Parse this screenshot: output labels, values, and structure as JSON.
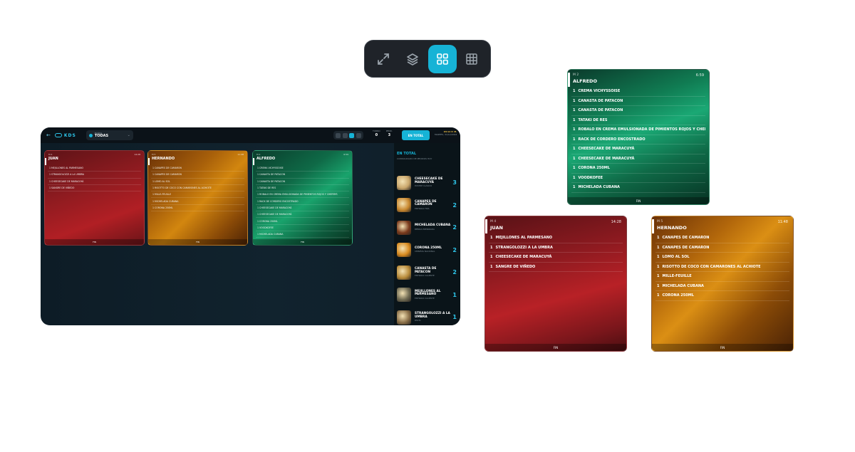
{
  "colors": {
    "accent": "#16b3d6",
    "red": "#b11f24",
    "orange": "#d2860f",
    "green": "#19a36c",
    "dark": "#0d1c26"
  },
  "switcher": {
    "buttons": [
      {
        "icon": "expand-icon",
        "active": false
      },
      {
        "icon": "layers-icon",
        "active": false
      },
      {
        "icon": "grid-2x2-icon",
        "active": true
      },
      {
        "icon": "grid-3x3-icon",
        "active": false
      }
    ]
  },
  "kds": {
    "brand": "KDS",
    "filter": {
      "label": "FILTRO",
      "value": "TODAS"
    },
    "stats": [
      {
        "label": "TURNO",
        "value": "0"
      },
      {
        "label": "PEND.",
        "value": "3"
      }
    ],
    "total_button": "EN TOTAL",
    "date_line1": "03:12 P. M.",
    "date_line2": "MARTES, 31/12/2024",
    "tickets": [
      {
        "key": "M 4",
        "time": "14:28",
        "name": "JUAN",
        "color": "red",
        "items": [
          "1 MEJILLONES AL PARMESANO",
          "1 STRANGOLOZZI A LA UMBRA",
          "1 CHEESECAKE DE MARACUYÁ",
          "1 SANGRE DE VIÑEDO"
        ],
        "footer": "FIN"
      },
      {
        "key": "M 5",
        "time": "11:48",
        "name": "HERNANDO",
        "color": "orange",
        "items": [
          "1 CANAPES DE CAMARON",
          "1 CANAPES DE CAMARON",
          "1 LOMO AL SOL",
          "1 RISOTTO DE COCO CON CAMARONES AL ACHIOTE",
          "1 MILLE-FEUILLE",
          "1 MICHELADA CUBANA",
          "1 CORONA 250ML"
        ],
        "footer": "FIN"
      },
      {
        "key": "M 2",
        "time": "6:59",
        "name": "ALFREDO",
        "color": "green",
        "items": [
          "1 CREMA VICHYSSOISE",
          "1 CANASTA DE PATACON",
          "1 CANASTA DE PATACON",
          "1 TATAKI DE RES",
          "1 ROBALO EN CREMA EMULSIONADA DE PIMIENTOS ROJOS Y CHERRYS",
          "1 RACK DE CORDERO ENCOSTRADO",
          "1 CHEESECAKE DE MARACUYÁ",
          "1 CHEESECAKE DE MARACUYÁ",
          "1 CORONA 250ML",
          "1 VOODKOFEE",
          "1 MICHELADA CUBANA"
        ],
        "footer": "FIN"
      }
    ],
    "panel": {
      "title": "EN TOTAL",
      "subtitle": "CONSOLIDADO DE PEDIDOS HOY",
      "items": [
        {
          "name": "CHEESECAKE DE MARACUYÁ",
          "sub": "POSTRE CLÁSICO",
          "qty": "3",
          "color": "#c9a66b"
        },
        {
          "name": "CANAPES DE CAMARON",
          "sub": "ENTRADA FRÍA",
          "qty": "2",
          "color": "#c8872e"
        },
        {
          "name": "MICHELADA CUBANA",
          "sub": "BEBIDA PREPARADA",
          "qty": "2",
          "color": "#7a3a1c"
        },
        {
          "name": "CORONA 250ML",
          "sub": "CERVEZA NACIONAL",
          "qty": "2",
          "color": "#d88a1f"
        },
        {
          "name": "CANASTA DE PATACON",
          "sub": "ENTRADA CALIENTE",
          "qty": "2",
          "color": "#b88b3a"
        },
        {
          "name": "MEJILLONES AL PARMESANO",
          "sub": "ENTRADA CALIENTE",
          "qty": "1",
          "color": "#6f6a52"
        },
        {
          "name": "STRANGOLOZZI A LA UMBRA",
          "sub": "PASTA",
          "qty": "1",
          "color": "#8a6f48"
        }
      ]
    }
  },
  "large_tickets": [
    {
      "key": "M 2",
      "time": "6:59",
      "name": "ALFREDO",
      "color": "green",
      "items": [
        {
          "q": "1",
          "name": "CREMA VICHYSSOISE"
        },
        {
          "q": "1",
          "name": "CANASTA DE PATACON"
        },
        {
          "q": "1",
          "name": "CANASTA DE PATACON"
        },
        {
          "q": "1",
          "name": "TATAKI DE RES"
        },
        {
          "q": "1",
          "name": "ROBALO EN CREMA EMULSIONADA DE PIMIENTOS ROJOS Y CHERRYS"
        },
        {
          "q": "1",
          "name": "RACK DE CORDERO ENCOSTRADO"
        },
        {
          "q": "1",
          "name": "CHEESECAKE DE MARACUYÁ"
        },
        {
          "q": "1",
          "name": "CHEESECAKE DE MARACUYÁ"
        },
        {
          "q": "1",
          "name": "CORONA 250ML"
        },
        {
          "q": "1",
          "name": "VOODKOFEE"
        },
        {
          "q": "1",
          "name": "MICHELADA CUBANA"
        }
      ],
      "footer": "FIN"
    },
    {
      "key": "M 4",
      "time": "14:28",
      "name": "JUAN",
      "color": "red",
      "items": [
        {
          "q": "1",
          "name": "MEJILLONES AL PARMESANO"
        },
        {
          "q": "1",
          "name": "STRANGOLOZZI A LA UMBRA"
        },
        {
          "q": "1",
          "name": "CHEESECAKE DE MARACUYÁ"
        },
        {
          "q": "1",
          "name": "SANGRE DE VIÑEDO"
        }
      ],
      "footer": "FIN"
    },
    {
      "key": "M 5",
      "time": "11:48",
      "name": "HERNANDO",
      "color": "orange",
      "items": [
        {
          "q": "1",
          "name": "CANAPES DE CAMARON"
        },
        {
          "q": "1",
          "name": "CANAPES DE CAMARON"
        },
        {
          "q": "1",
          "name": "LOMO AL SOL"
        },
        {
          "q": "1",
          "name": "RISOTTO DE COCO CON CAMARONES AL ACHIOTE"
        },
        {
          "q": "1",
          "name": "MILLE-FEUILLE"
        },
        {
          "q": "1",
          "name": "MICHELADA CUBANA"
        },
        {
          "q": "1",
          "name": "CORONA 250ML"
        }
      ],
      "footer": "FIN"
    }
  ]
}
